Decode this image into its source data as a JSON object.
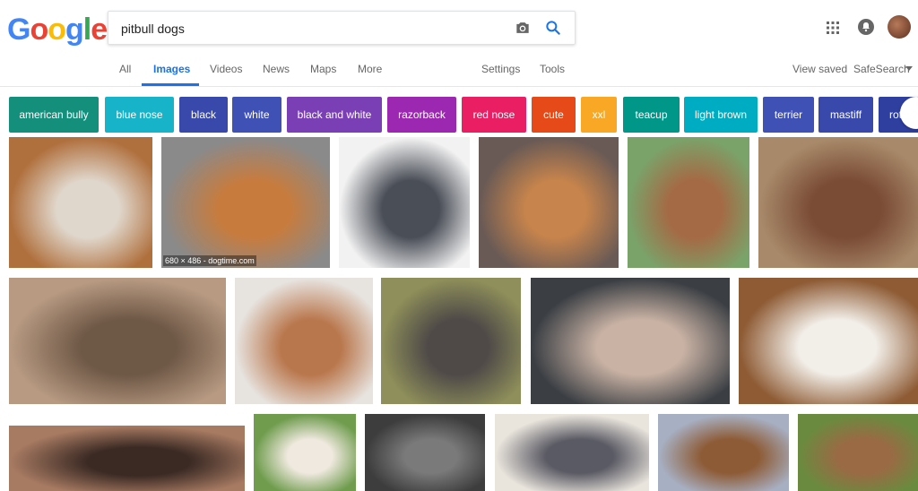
{
  "logo": {
    "letters": [
      "G",
      "o",
      "o",
      "g",
      "l",
      "e"
    ],
    "colors": [
      "#4285F4",
      "#EA4335",
      "#FBBC05",
      "#4285F4",
      "#34A853",
      "#EA4335"
    ]
  },
  "search": {
    "value": "pitbull dogs"
  },
  "tabs": [
    "All",
    "Images",
    "Videos",
    "News",
    "Maps",
    "More",
    "Settings",
    "Tools"
  ],
  "active_tab": "Images",
  "right_links": {
    "view_saved": "View saved",
    "safesearch": "SafeSearch"
  },
  "chips": [
    {
      "label": "american bully",
      "color": "#138f7b"
    },
    {
      "label": "blue nose",
      "color": "#17b3c8"
    },
    {
      "label": "black",
      "color": "#3949ab"
    },
    {
      "label": "white",
      "color": "#3f51b5"
    },
    {
      "label": "black and white",
      "color": "#7b3fb5"
    },
    {
      "label": "razorback",
      "color": "#9c27b0"
    },
    {
      "label": "red nose",
      "color": "#e91e63"
    },
    {
      "label": "cute",
      "color": "#e64a19"
    },
    {
      "label": "xxl",
      "color": "#f9a825"
    },
    {
      "label": "teacup",
      "color": "#009688"
    },
    {
      "label": "light brown",
      "color": "#00acc1"
    },
    {
      "label": "terrier",
      "color": "#3f51b5"
    },
    {
      "label": "mastiff",
      "color": "#3949ab"
    },
    {
      "label": "rottw",
      "color": "#2f3f9f"
    }
  ],
  "images": [
    {
      "name": "pitbull-image-1",
      "colors": [
        "#b0703e",
        "#e0d7cc"
      ]
    },
    {
      "name": "pitbull-image-2",
      "colors": [
        "#8a8a8a",
        "#c77c3e"
      ],
      "caption": "680 × 486 - dogtime.com"
    },
    {
      "name": "pitbull-image-3",
      "colors": [
        "#f2f2f2",
        "#4a4e57"
      ]
    },
    {
      "name": "pitbull-image-4",
      "colors": [
        "#6a5a55",
        "#c7844c"
      ]
    },
    {
      "name": "pitbull-image-5",
      "colors": [
        "#7aa36a",
        "#a46a45"
      ]
    },
    {
      "name": "pitbull-image-6",
      "colors": [
        "#a88a6a",
        "#7a4b35"
      ]
    },
    {
      "name": "pitbull-image-7",
      "colors": [
        "#b89a82",
        "#6e5846"
      ]
    },
    {
      "name": "pitbull-image-8",
      "colors": [
        "#e7e3df",
        "#b9774d"
      ]
    },
    {
      "name": "pitbull-image-9",
      "colors": [
        "#8e8f5a",
        "#4f4a48"
      ]
    },
    {
      "name": "pitbull-image-10",
      "colors": [
        "#3b3f44",
        "#c9b2a4"
      ]
    },
    {
      "name": "pitbull-image-11",
      "colors": [
        "#8e5b35",
        "#f2eee8"
      ]
    },
    {
      "name": "pitbull-image-12",
      "colors": [
        "#a77a62",
        "#3b2a24"
      ]
    },
    {
      "name": "pitbull-image-13",
      "colors": [
        "#6f9c4d",
        "#f0e9df"
      ]
    },
    {
      "name": "pitbull-image-14",
      "colors": [
        "#3d3d3d",
        "#7a7a7a"
      ]
    },
    {
      "name": "pitbull-image-15",
      "colors": [
        "#e9e4dc",
        "#5a5a64"
      ]
    },
    {
      "name": "pitbull-image-16",
      "colors": [
        "#a7b0c2",
        "#8d5b35"
      ]
    },
    {
      "name": "pitbull-image-17",
      "colors": [
        "#6a8b3f",
        "#9a6a44"
      ]
    }
  ]
}
